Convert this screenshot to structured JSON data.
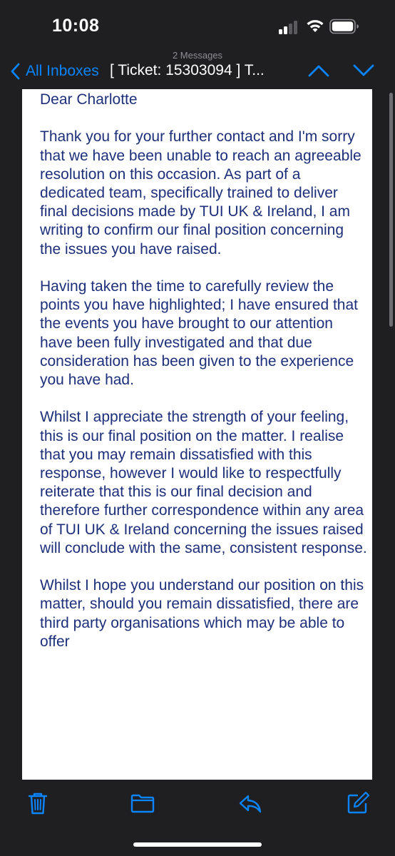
{
  "status_bar": {
    "time": "10:08",
    "signal_icon": "cellular-signal-icon",
    "wifi_icon": "wifi-icon",
    "battery_icon": "battery-icon"
  },
  "nav": {
    "message_count": "2 Messages",
    "back_label": "All Inboxes",
    "title": "[ Ticket: 15303094 ] T...",
    "accent_color": "#0a84ff",
    "prev_icon": "chevron-up-icon",
    "next_icon": "chevron-down-icon"
  },
  "email": {
    "text_color": "#1d2f7a",
    "greeting": "Dear Charlotte",
    "paragraphs": [
      "Thank you for your further contact and I'm sorry that we have been unable to reach an agreeable resolution on this occasion. As part of a dedicated team, specifically trained to deliver final decisions made by TUI UK & Ireland, I am writing to confirm our final position concerning the issues you have raised.",
      "Having taken the time to carefully review the points you have highlighted; I have ensured that the events you have brought to our attention have been fully investigated and that due consideration has been given to the experience you have had.",
      "Whilst I appreciate the strength of your feeling, this is our final position on the matter. I realise that you may remain dissatisfied with this response, however I would like to respectfully reiterate that this is our final decision and therefore further correspondence within any area of TUI UK & Ireland concerning the issues raised will conclude with the same, consistent response.",
      "Whilst I hope you understand our position on this matter, should you remain dissatisfied, there are third party organisations which may be able to offer"
    ]
  },
  "toolbar": {
    "delete_icon": "trash-icon",
    "move_icon": "folder-icon",
    "reply_icon": "reply-icon",
    "compose_icon": "compose-icon"
  }
}
